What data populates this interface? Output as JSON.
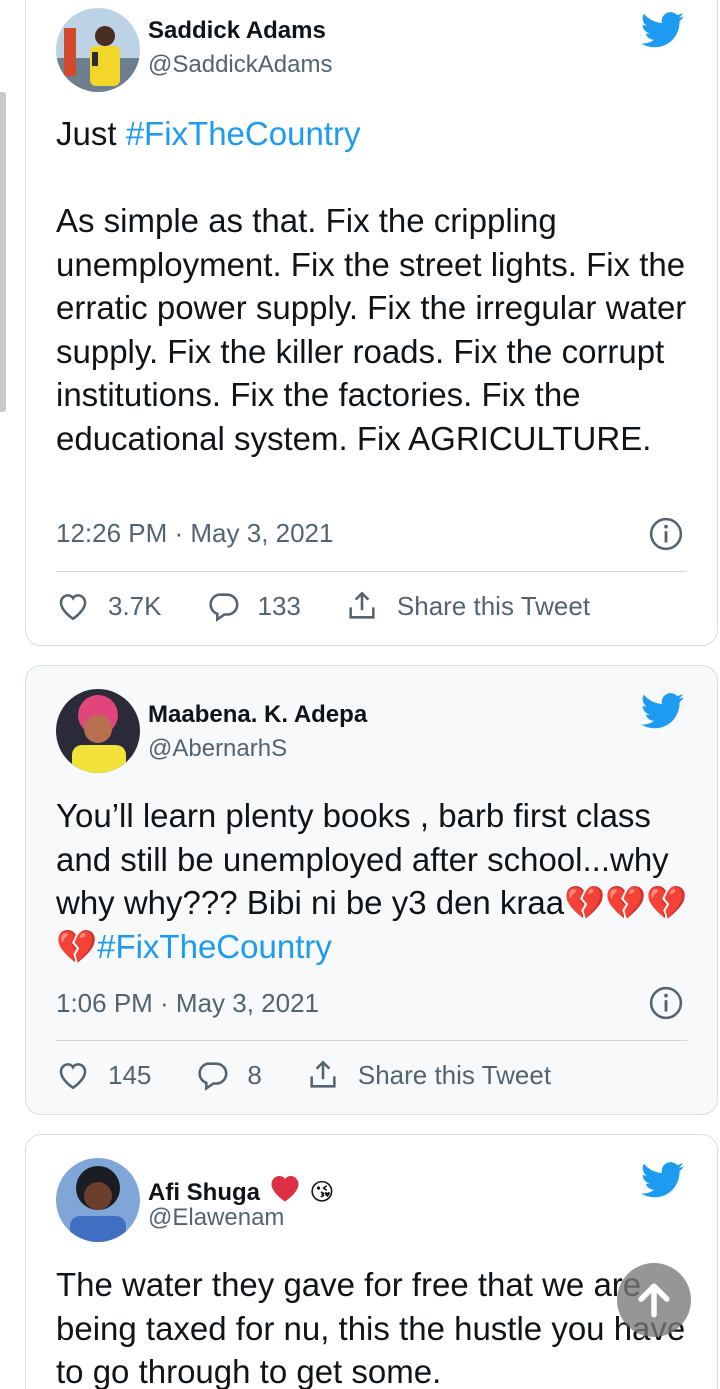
{
  "tweets": [
    {
      "name": "Saddick Adams",
      "handle": "@SaddickAdams",
      "text_line1_prefix": "Just ",
      "text_line1_tag": "#FixTheCountry",
      "text_body": "As simple as that. Fix the crippling unemployment. Fix the street lights. Fix the erratic power supply. Fix the irregular water supply. Fix the killer roads. Fix the corrupt institutions. Fix the factories. Fix the educational system. Fix AGRICULTURE.",
      "timestamp": "12:26 PM · May 3, 2021",
      "likes": "3.7K",
      "replies": "133",
      "share_label": "Share this Tweet"
    },
    {
      "name": "Maabena. K. Adepa",
      "handle": "@AbernarhS",
      "text": "You’ll learn plenty books , barb first class and still be unemployed after school...why why why??? Bibi ni be y3 den kraa",
      "emoji": "💔💔💔💔",
      "tag": "#FixTheCountry",
      "timestamp": "1:06 PM · May 3, 2021",
      "likes": "145",
      "replies": "8",
      "share_label": "Share this Tweet"
    },
    {
      "name": "Afi Shuga",
      "name_emoji": "😘",
      "handle": "@Elawenam",
      "text": "The water they gave for free that we are being taxed for nu, this the hustle you have to go through to get some."
    }
  ],
  "colors": {
    "accent": "#1d9bf0",
    "text": "#0f1419",
    "muted": "#536471"
  },
  "icons": [
    "twitter-bird-icon",
    "info-icon",
    "heart-icon",
    "reply-icon",
    "share-icon",
    "arrow-up-icon"
  ]
}
